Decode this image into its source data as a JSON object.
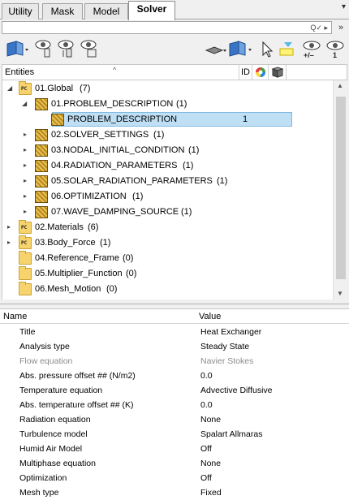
{
  "tabs": [
    {
      "label": "Utility"
    },
    {
      "label": "Mask"
    },
    {
      "label": "Model"
    },
    {
      "label": "Solver"
    }
  ],
  "toolbar": {
    "config_label": "+/–",
    "count_label": "1"
  },
  "entities_header": {
    "entities": "Entities",
    "id": "ID"
  },
  "tree": [
    {
      "label": "01.Global",
      "count": "(7)"
    },
    {
      "label": "01.PROBLEM_DESCRIPTION",
      "count": "(1)"
    },
    {
      "label": "PROBLEM_DESCRIPTION",
      "count": "1"
    },
    {
      "label": "02.SOLVER_SETTINGS",
      "count": "(1)"
    },
    {
      "label": "03.NODAL_INITIAL_CONDITION",
      "count": "(1)"
    },
    {
      "label": "04.RADIATION_PARAMETERS",
      "count": "(1)"
    },
    {
      "label": "05.SOLAR_RADIATION_PARAMETERS",
      "count": "(1)"
    },
    {
      "label": "06.OPTIMIZATION",
      "count": "(1)"
    },
    {
      "label": "07.WAVE_DAMPING_SOURCE",
      "count": "(1)"
    },
    {
      "label": "02.Materials",
      "count": "(6)"
    },
    {
      "label": "03.Body_Force",
      "count": "(1)"
    },
    {
      "label": "04.Reference_Frame",
      "count": "(0)"
    },
    {
      "label": "05.Multiplier_Function",
      "count": "(0)"
    },
    {
      "label": "06.Mesh_Motion",
      "count": "(0)"
    }
  ],
  "props_header": {
    "name": "Name",
    "value": "Value"
  },
  "properties": [
    {
      "name": "Title",
      "value": "Heat Exchanger"
    },
    {
      "name": "Analysis type",
      "value": "Steady State"
    },
    {
      "name": "Flow equation",
      "value": "Navier Stokes"
    },
    {
      "name": "Abs. pressure offset ## (N/m2)",
      "value": "0.0"
    },
    {
      "name": "Temperature equation",
      "value": "Advective Diffusive"
    },
    {
      "name": "Abs. temperature offset ## (K)",
      "value": "0.0"
    },
    {
      "name": "Radiation equation",
      "value": "None"
    },
    {
      "name": "Turbulence model",
      "value": "Spalart Allmaras"
    },
    {
      "name": "Humid Air Model",
      "value": "Off"
    },
    {
      "name": "Multiphase equation",
      "value": "None"
    },
    {
      "name": "Optimization",
      "value": "Off"
    },
    {
      "name": "Mesh type",
      "value": "Fixed"
    }
  ],
  "colors": {
    "selection": "#bfdff5",
    "selection_border": "#7fb8e0",
    "disabled_text": "#8c8c8c"
  }
}
